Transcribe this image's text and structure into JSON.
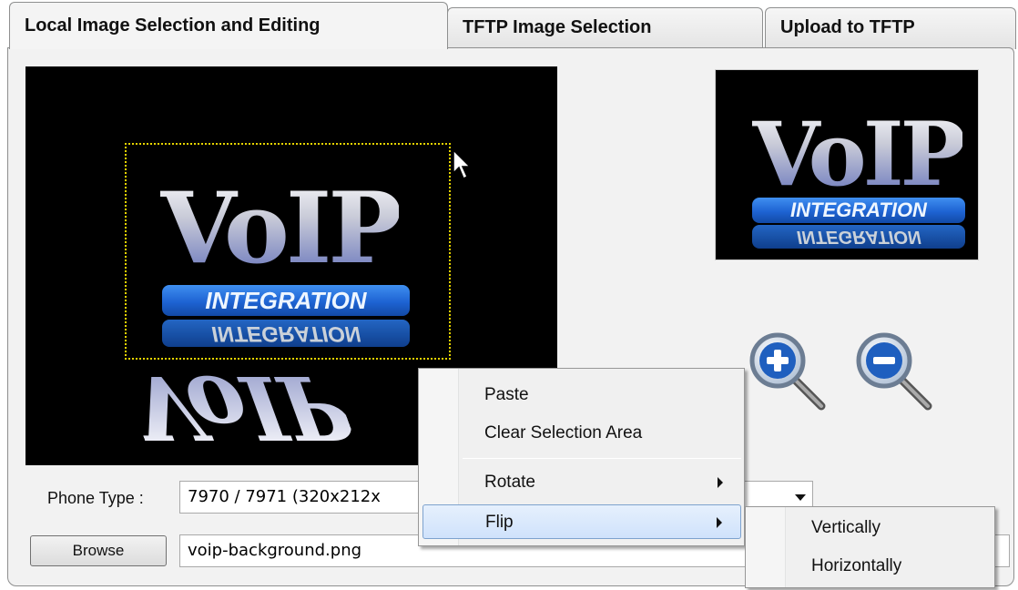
{
  "tabs": [
    {
      "label": "Local Image Selection and Editing",
      "active": true
    },
    {
      "label": "TFTP Image Selection",
      "active": false
    },
    {
      "label": "Upload to TFTP",
      "active": false
    }
  ],
  "image": {
    "logo_text": "VoIP",
    "banner_text": "INTEGRATION",
    "banner_reflection": "INTEGRATION"
  },
  "zoom": {
    "zoom_in_icon": "zoom-in-icon",
    "zoom_out_icon": "zoom-out-icon"
  },
  "phone_type": {
    "label": "Phone Type :",
    "value": "7970 / 7971 (320x212x"
  },
  "browse": {
    "button_label": "Browse",
    "file_value": "voip-background.png"
  },
  "context_menu": {
    "items": [
      "Paste",
      "Clear Selection Area",
      "Rotate",
      "Flip"
    ],
    "highlighted": "Flip",
    "submenu_items": [
      "Vertically",
      "Horizontally"
    ]
  },
  "colors": {
    "selection_border": "#e8d400",
    "menu_highlight": "#cfe2fb",
    "banner_blue": "#1e63d3"
  }
}
